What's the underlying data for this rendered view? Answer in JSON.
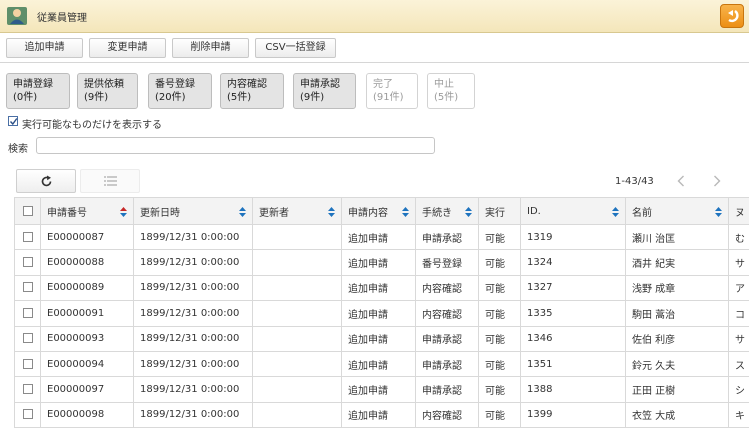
{
  "app": {
    "title": "従業員管理"
  },
  "toolbar": {
    "add": "追加申請",
    "change": "変更申請",
    "delete": "削除申請",
    "csv": "CSV一括登録"
  },
  "status_buttons": [
    {
      "label": "申請登録",
      "count": "(0件)"
    },
    {
      "label": "提供依頼",
      "count": "(9件)"
    },
    {
      "label": "番号登録",
      "count": "(20件)"
    },
    {
      "label": "内容確認",
      "count": "(5件)"
    },
    {
      "label": "申請承認",
      "count": "(9件)"
    },
    {
      "label": "完了",
      "count": "(91件)"
    },
    {
      "label": "中止",
      "count": "(5件)"
    }
  ],
  "filter": {
    "executable_only_label": "実行可能なものだけを表示する",
    "executable_only_checked": true
  },
  "search": {
    "label": "検索",
    "value": "",
    "placeholder": ""
  },
  "pagination": {
    "range": "1-43/43"
  },
  "table": {
    "columns": [
      "申請番号",
      "更新日時",
      "更新者",
      "申請内容",
      "手続き",
      "実行",
      "ID.",
      "名前",
      "ヌ"
    ],
    "rows": [
      [
        "E00000087",
        "1899/12/31 0:00:00",
        "",
        "追加申請",
        "申請承認",
        "可能",
        "1319",
        "瀬川 治匡",
        "む"
      ],
      [
        "E00000088",
        "1899/12/31 0:00:00",
        "",
        "追加申請",
        "番号登録",
        "可能",
        "1324",
        "酒井 紀実",
        "サ"
      ],
      [
        "E00000089",
        "1899/12/31 0:00:00",
        "",
        "追加申請",
        "内容確認",
        "可能",
        "1327",
        "浅野 成章",
        "ア"
      ],
      [
        "E00000091",
        "1899/12/31 0:00:00",
        "",
        "追加申請",
        "内容確認",
        "可能",
        "1335",
        "駒田 蒿治",
        "コ"
      ],
      [
        "E00000093",
        "1899/12/31 0:00:00",
        "",
        "追加申請",
        "申請承認",
        "可能",
        "1346",
        "佐伯 利彦",
        "サ"
      ],
      [
        "E00000094",
        "1899/12/31 0:00:00",
        "",
        "追加申請",
        "申請承認",
        "可能",
        "1351",
        "鈴元 久夫",
        "ス"
      ],
      [
        "E00000097",
        "1899/12/31 0:00:00",
        "",
        "追加申請",
        "申請承認",
        "可能",
        "1388",
        "正田 正樹",
        "シ"
      ],
      [
        "E00000098",
        "1899/12/31 0:00:00",
        "",
        "追加申請",
        "内容確認",
        "可能",
        "1399",
        "衣笠 大成",
        "キ"
      ]
    ]
  },
  "colors": {
    "title_bar": "#f4e6ba",
    "back_button": "#ec8f15",
    "sort_up": "#c62828",
    "sort_down": "#1e73be"
  }
}
